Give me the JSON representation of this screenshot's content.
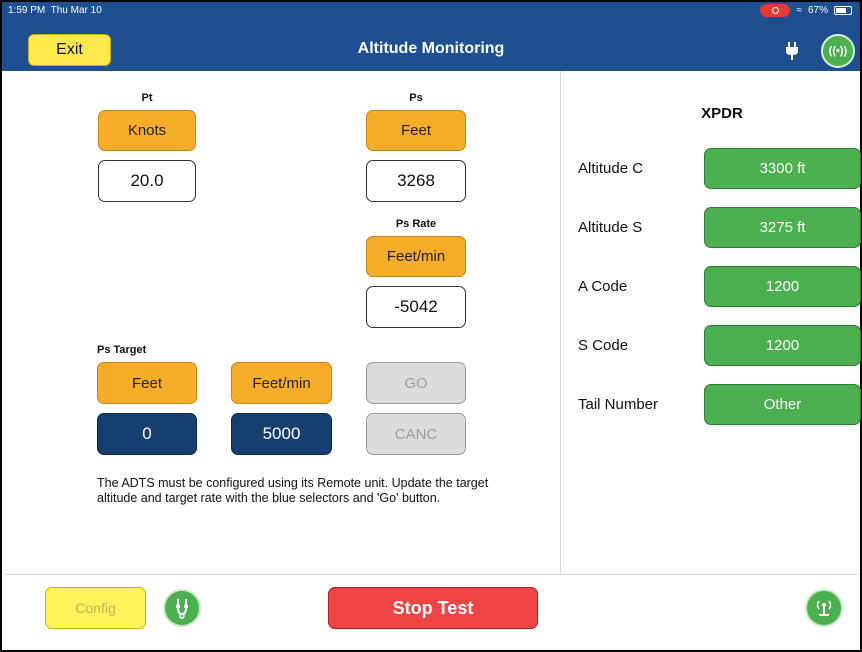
{
  "status_bar": {
    "time": "1:59 PM",
    "date": "Thu Mar 10",
    "battery": "67%"
  },
  "header": {
    "exit_label": "Exit",
    "title": "Altitude Monitoring"
  },
  "pt": {
    "label": "Pt",
    "unit": "Knots",
    "value": "20.0"
  },
  "ps": {
    "label": "Ps",
    "unit": "Feet",
    "value": "3268"
  },
  "ps_rate": {
    "label": "Ps Rate",
    "unit": "Feet/min",
    "value": "-5042"
  },
  "ps_target": {
    "label": "Ps Target",
    "alt_unit": "Feet",
    "rate_unit": "Feet/min",
    "alt_value": "0",
    "rate_value": "5000",
    "go_label": "GO",
    "canc_label": "CANC"
  },
  "note": "The ADTS must be configured using its Remote unit. Update the target altitude and target rate with the blue selectors and 'Go' button.",
  "xpdr": {
    "title": "XPDR",
    "rows": [
      {
        "label": "Altitude C",
        "value": "3300 ft"
      },
      {
        "label": "Altitude S",
        "value": "3275 ft"
      },
      {
        "label": "A Code",
        "value": "1200"
      },
      {
        "label": "S Code",
        "value": "1200"
      },
      {
        "label": "Tail Number",
        "value": "Other"
      }
    ]
  },
  "footer": {
    "config_label": "Config",
    "stop_label": "Stop Test"
  },
  "icons": {
    "wireless": "wireless-icon",
    "plug": "plug-icon",
    "cable": "cable-connection-icon",
    "antenna": "antenna-icon"
  },
  "colors": {
    "header": "#1d4f91",
    "orange_button": "#f8ad2a",
    "navy_selector": "#163e6e",
    "green_value": "#4caf50",
    "stop_red": "#ef4444",
    "yellow_button": "#ffe94d"
  }
}
